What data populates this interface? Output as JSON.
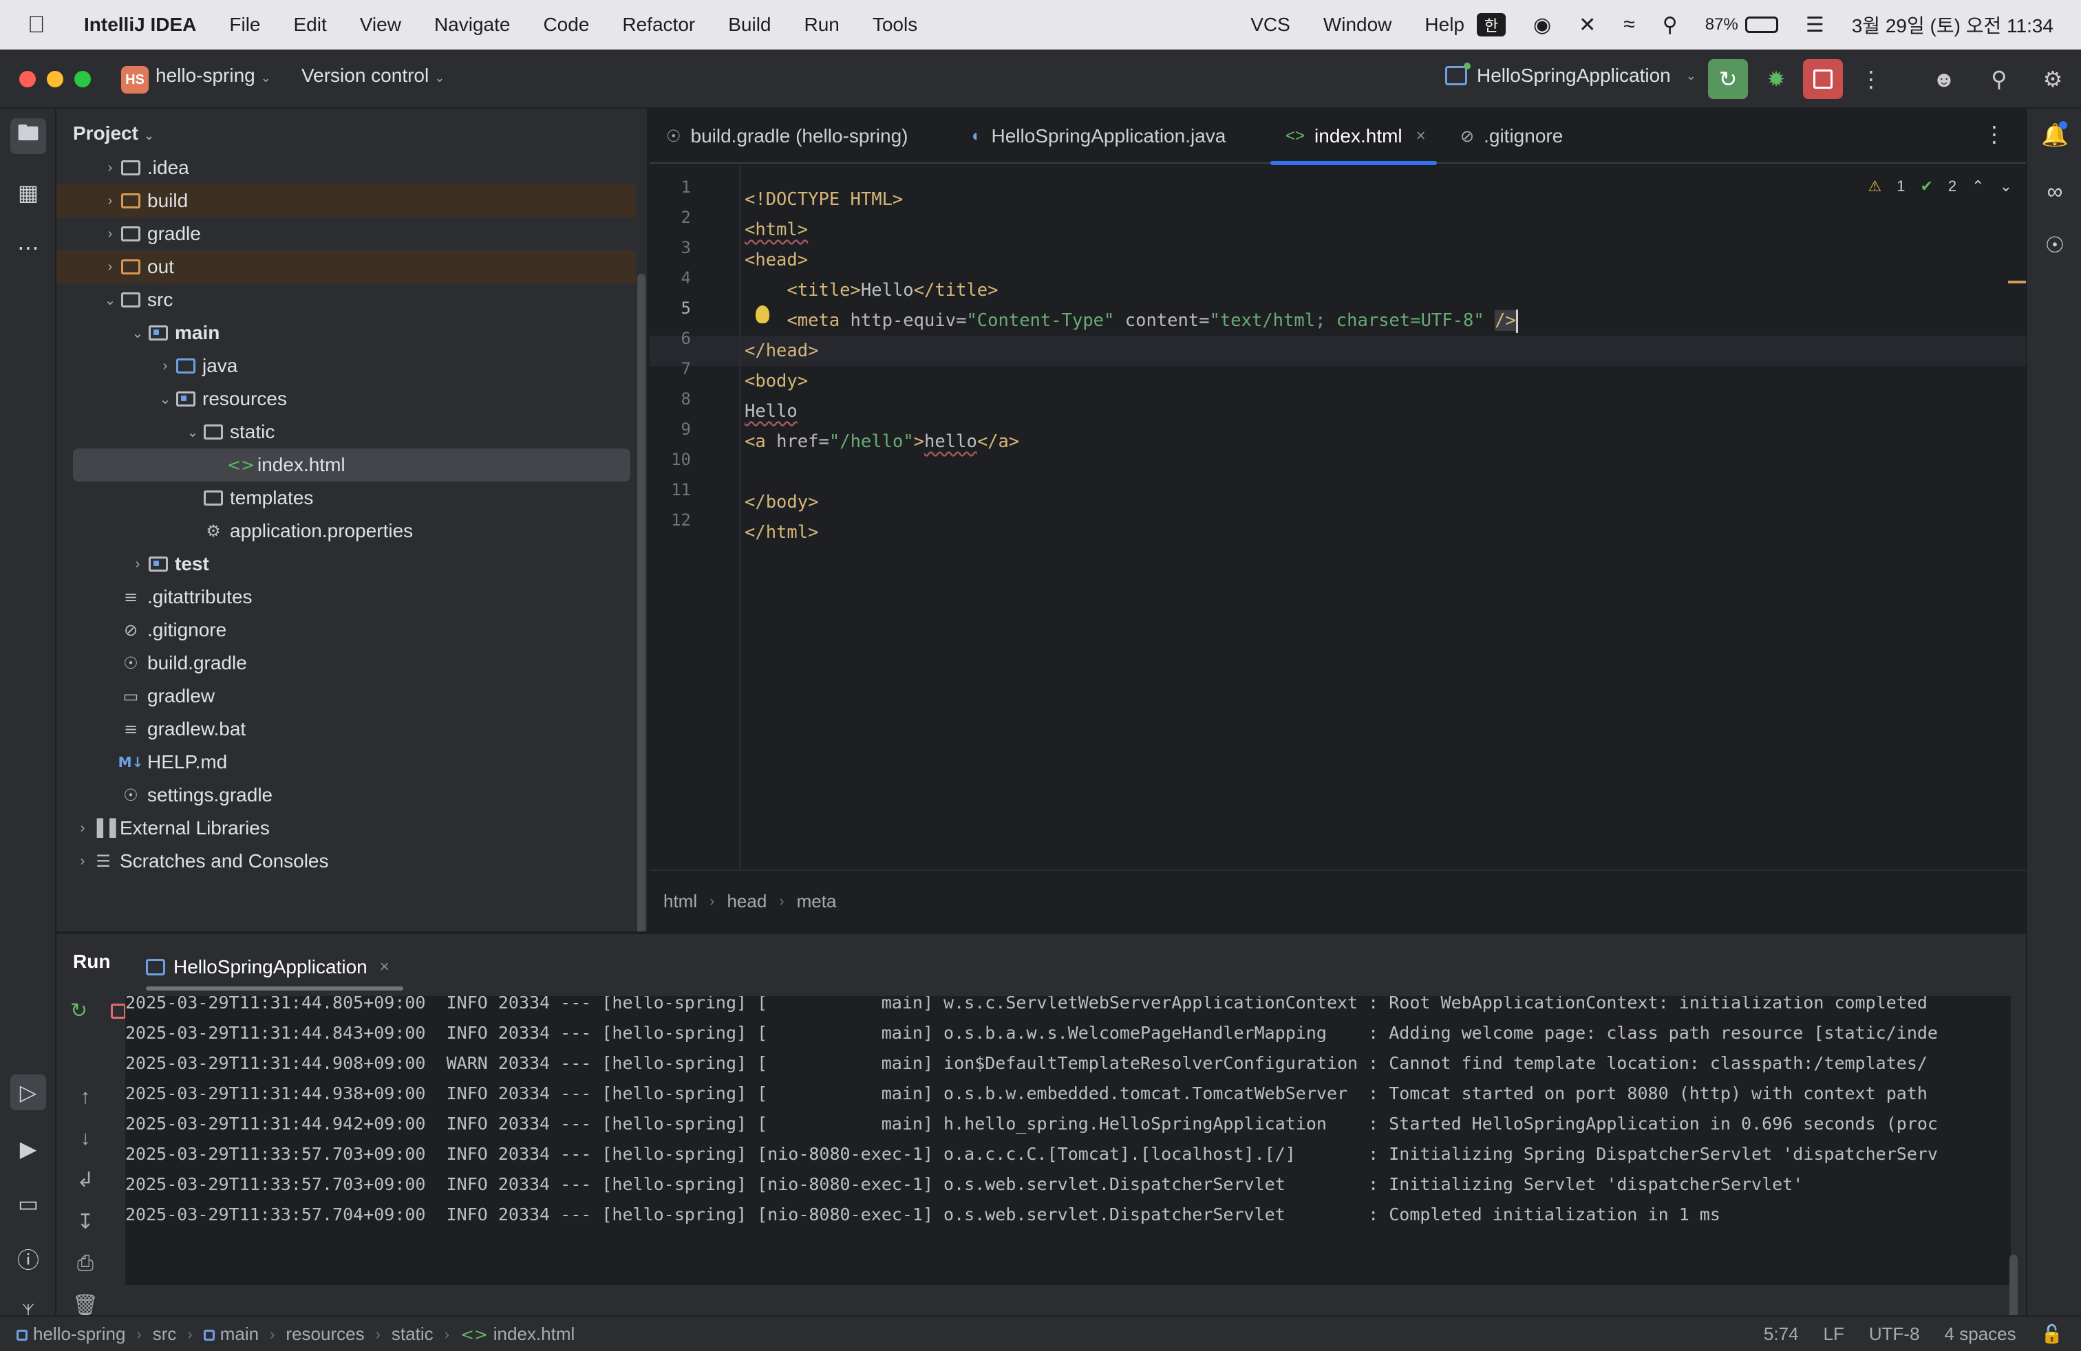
{
  "menubar": {
    "app_name": "IntelliJ IDEA",
    "items": [
      "File",
      "Edit",
      "View",
      "Navigate",
      "Code",
      "Refactor",
      "Build",
      "Run",
      "Tools"
    ],
    "right_items": [
      "VCS",
      "Window",
      "Help"
    ],
    "input_method": "한",
    "battery_percent": "87%",
    "battery_level": 0.87,
    "datetime": "3월 29일 (토) 오전 11:34"
  },
  "titlebar": {
    "project_badge": "HS",
    "project_name": "hello-spring",
    "version_control": "Version control",
    "run_config": "HelloSpringApplication"
  },
  "project_panel": {
    "title": "Project",
    "tree": [
      {
        "label": ".idea",
        "kind": "folder",
        "depth": 1,
        "expanded": false
      },
      {
        "label": "build",
        "kind": "folder-orange",
        "depth": 1,
        "expanded": false,
        "excluded": true
      },
      {
        "label": "gradle",
        "kind": "folder",
        "depth": 1,
        "expanded": false
      },
      {
        "label": "out",
        "kind": "folder-orange",
        "depth": 1,
        "expanded": false,
        "excluded": true
      },
      {
        "label": "src",
        "kind": "folder",
        "depth": 1,
        "expanded": true
      },
      {
        "label": "main",
        "kind": "folder-module",
        "depth": 2,
        "expanded": true
      },
      {
        "label": "java",
        "kind": "folder-blue",
        "depth": 3,
        "expanded": false
      },
      {
        "label": "resources",
        "kind": "folder-res",
        "depth": 3,
        "expanded": true
      },
      {
        "label": "static",
        "kind": "folder",
        "depth": 4,
        "expanded": true
      },
      {
        "label": "index.html",
        "kind": "html",
        "depth": 5,
        "selected": true
      },
      {
        "label": "templates",
        "kind": "folder",
        "depth": 4
      },
      {
        "label": "application.properties",
        "kind": "gear",
        "depth": 4
      },
      {
        "label": "test",
        "kind": "folder-module",
        "depth": 2,
        "expanded": false
      },
      {
        "label": ".gitattributes",
        "kind": "lines",
        "depth": 1
      },
      {
        "label": ".gitignore",
        "kind": "ignore",
        "depth": 1
      },
      {
        "label": "build.gradle",
        "kind": "gradle",
        "depth": 1
      },
      {
        "label": "gradlew",
        "kind": "terminal",
        "depth": 1
      },
      {
        "label": "gradlew.bat",
        "kind": "lines",
        "depth": 1
      },
      {
        "label": "HELP.md",
        "kind": "md",
        "depth": 1
      },
      {
        "label": "settings.gradle",
        "kind": "gradle",
        "depth": 1
      },
      {
        "label": "External Libraries",
        "kind": "libs",
        "depth": 0,
        "expanded": false
      },
      {
        "label": "Scratches and Consoles",
        "kind": "scratch",
        "depth": 0,
        "expanded": false
      }
    ]
  },
  "editor": {
    "tabs": [
      {
        "label": "build.gradle (hello-spring)",
        "icon": "gradle-icon"
      },
      {
        "label": "HelloSpringApplication.java",
        "icon": "java-class-icon"
      },
      {
        "label": "index.html",
        "icon": "html-icon",
        "active": true
      },
      {
        "label": ".gitignore",
        "icon": "gitignore-icon"
      }
    ],
    "line_numbers": [
      "1",
      "2",
      "3",
      "4",
      "5",
      "6",
      "7",
      "8",
      "9",
      "10",
      "11",
      "12"
    ],
    "current_line": 5,
    "inspections": {
      "warnings": "1",
      "ok": "2"
    },
    "breadcrumb": [
      "html",
      "head",
      "meta"
    ]
  },
  "run_panel": {
    "title": "Run",
    "tab_label": "HelloSpringApplication",
    "log_lines": [
      "2025-03-29T11:31:44.805+09:00  INFO 20334 --- [hello-spring] [           main] w.s.c.ServletWebServerApplicationContext : Root WebApplicationContext: initialization completed",
      "2025-03-29T11:31:44.843+09:00  INFO 20334 --- [hello-spring] [           main] o.s.b.a.w.s.WelcomePageHandlerMapping    : Adding welcome page: class path resource [static/inde",
      "2025-03-29T11:31:44.908+09:00  WARN 20334 --- [hello-spring] [           main] ion$DefaultTemplateResolverConfiguration : Cannot find template location: classpath:/templates/",
      "2025-03-29T11:31:44.938+09:00  INFO 20334 --- [hello-spring] [           main] o.s.b.w.embedded.tomcat.TomcatWebServer  : Tomcat started on port 8080 (http) with context path",
      "2025-03-29T11:31:44.942+09:00  INFO 20334 --- [hello-spring] [           main] h.hello_spring.HelloSpringApplication    : Started HelloSpringApplication in 0.696 seconds (proc",
      "2025-03-29T11:33:57.703+09:00  INFO 20334 --- [hello-spring] [nio-8080-exec-1] o.a.c.c.C.[Tomcat].[localhost].[/]       : Initializing Spring DispatcherServlet 'dispatcherServ",
      "2025-03-29T11:33:57.703+09:00  INFO 20334 --- [hello-spring] [nio-8080-exec-1] o.s.web.servlet.DispatcherServlet        : Initializing Servlet 'dispatcherServlet'",
      "2025-03-29T11:33:57.704+09:00  INFO 20334 --- [hello-spring] [nio-8080-exec-1] o.s.web.servlet.DispatcherServlet        : Completed initialization in 1 ms"
    ]
  },
  "statusbar": {
    "crumbs": [
      "hello-spring",
      "src",
      "main",
      "resources",
      "static",
      "index.html"
    ],
    "position": "5:74",
    "line_sep": "LF",
    "encoding": "UTF-8",
    "indent": "4 spaces"
  },
  "code": {
    "l1": "<!DOCTYPE HTML>",
    "l2": "<html>",
    "l3": "<head>",
    "l4_open": "<title>",
    "l4_text": "Hello",
    "l4_close": "</title>",
    "l5_tag": "<meta",
    "l5_a1": "http-equiv",
    "l5_v1": "\"Content-Type\"",
    "l5_a2": "content",
    "l5_v2": "\"text/html; charset=UTF-8\"",
    "l5_end": "/>",
    "l6": "</head>",
    "l7": "<body>",
    "l8": "Hello",
    "l9_open": "<a",
    "l9_attr": "href",
    "l9_val": "\"/hello\"",
    "l9_gt": ">",
    "l9_text": "hello",
    "l9_close": "</a>",
    "l11": "</body>",
    "l12": "</html>"
  }
}
